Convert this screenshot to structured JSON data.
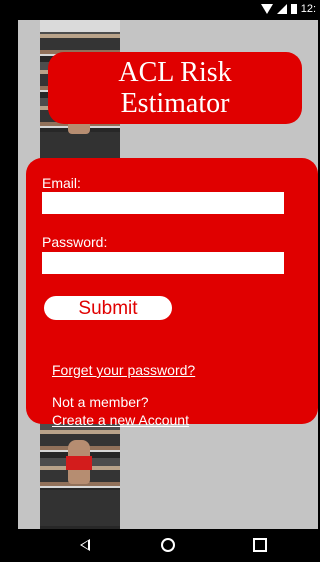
{
  "status": {
    "time": "12:"
  },
  "header": {
    "title": "ACL Risk\nEstimator"
  },
  "form": {
    "email_label": "Email:",
    "email_value": "",
    "email_placeholder": "",
    "password_label": "Password:",
    "password_value": "",
    "password_placeholder": "",
    "submit_label": "Submit"
  },
  "links": {
    "forgot_password": "Forget your password?",
    "not_member": "Not a member?",
    "create_account": "Create a new Account"
  },
  "icons": {
    "wifi": "wifi-icon",
    "signal": "signal-icon",
    "battery": "battery-icon",
    "back": "back-icon",
    "home": "home-icon",
    "recent": "recent-apps-icon"
  },
  "colors": {
    "primary_red": "#e00000",
    "background_gray": "#c4c4c4",
    "white": "#ffffff",
    "black": "#000000"
  }
}
